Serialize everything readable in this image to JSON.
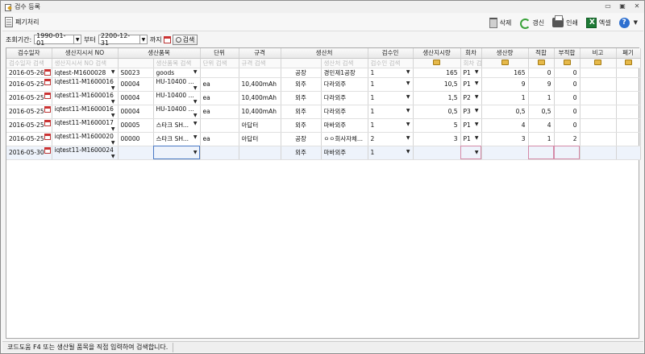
{
  "window": {
    "title": "검수 등록"
  },
  "toolbar": {
    "process_label": "폐기처리",
    "delete_label": "삭제",
    "refresh_label": "갱신",
    "print_label": "인쇄",
    "excel_label": "엑셀"
  },
  "filter": {
    "period_label": "조회기간:",
    "from_date": "1990-01-01",
    "from_suffix": "부터",
    "to_date": "2200-12-31",
    "to_suffix": "까지",
    "search_label": "검색"
  },
  "table": {
    "headers": [
      "검수일자",
      "생산지시서 NO",
      "생산품목",
      "단위",
      "규격",
      "생산처",
      "검수인",
      "생산지시량",
      "회차",
      "생산량",
      "적합",
      "부적합",
      "비고",
      "폐기"
    ],
    "filter_placeholders": [
      "검수일자 검색",
      "생산지시서 NO 검색",
      "생산품목 검색",
      "단위 검색",
      "규격 검색",
      "생산처 검색",
      "검수인 검색",
      "",
      "회차 검색",
      "",
      "",
      "",
      "",
      ""
    ],
    "rows": [
      {
        "date": "2016-05-26",
        "order": "iqtest-M1600028",
        "code": "S0023",
        "item": "goods",
        "unit": "",
        "spec": "",
        "place_type": "공장",
        "place": "경민제1공장",
        "inspector": "1",
        "qty": "165",
        "round": "P1",
        "prod": "165",
        "ok": "0",
        "ng": "0",
        "note": "",
        "disposal": ""
      },
      {
        "date": "2016-05-25",
        "order": "iqtest11-M1600016",
        "code": "00004",
        "item": "HU-10400 ...",
        "unit": "ea",
        "spec": "10,400mAh",
        "place_type": "외주",
        "place": "다라외주",
        "inspector": "1",
        "qty": "10,5",
        "round": "P1",
        "prod": "9",
        "ok": "9",
        "ng": "0",
        "note": "",
        "disposal": ""
      },
      {
        "date": "2016-05-25",
        "order": "iqtest11-M1600016",
        "code": "00004",
        "item": "HU-10400 ...",
        "unit": "ea",
        "spec": "10,400mAh",
        "place_type": "외주",
        "place": "다라외주",
        "inspector": "1",
        "qty": "1,5",
        "round": "P2",
        "prod": "1",
        "ok": "1",
        "ng": "0",
        "note": "",
        "disposal": ""
      },
      {
        "date": "2016-05-25",
        "order": "iqtest11-M1600016",
        "code": "00004",
        "item": "HU-10400 ...",
        "unit": "ea",
        "spec": "10,400mAh",
        "place_type": "외주",
        "place": "다라외주",
        "inspector": "1",
        "qty": "0,5",
        "round": "P3",
        "prod": "0,5",
        "ok": "0,5",
        "ng": "0",
        "note": "",
        "disposal": ""
      },
      {
        "date": "2016-05-25",
        "order": "iqtest11-M1600017",
        "code": "00005",
        "item": "스타크 SH...",
        "unit": "",
        "spec": "아답터",
        "place_type": "외주",
        "place": "마바외주",
        "inspector": "1",
        "qty": "5",
        "round": "P1",
        "prod": "4",
        "ok": "4",
        "ng": "0",
        "note": "",
        "disposal": ""
      },
      {
        "date": "2016-05-25",
        "order": "iqtest11-M1600020",
        "code": "00000",
        "item": "스타크 SH...",
        "unit": "ea",
        "spec": "아답터",
        "place_type": "공장",
        "place": "ㅇㅇ회사자체...",
        "inspector": "2",
        "qty": "3",
        "round": "P1",
        "prod": "3",
        "ok": "1",
        "ng": "2",
        "note": "",
        "disposal": ""
      },
      {
        "date": "2016-05-30",
        "order": "iqtest11-M1600024",
        "code": "",
        "item": "",
        "unit": "",
        "spec": "",
        "place_type": "외주",
        "place": "마바외주",
        "inspector": "1",
        "qty": "",
        "round": "",
        "prod": "",
        "ok": "",
        "ng": "",
        "note": "",
        "disposal": ""
      }
    ]
  },
  "status": {
    "hint": "코드도움 F4 또는 생산될 품목을 직접 입력하여 검색합니다."
  }
}
